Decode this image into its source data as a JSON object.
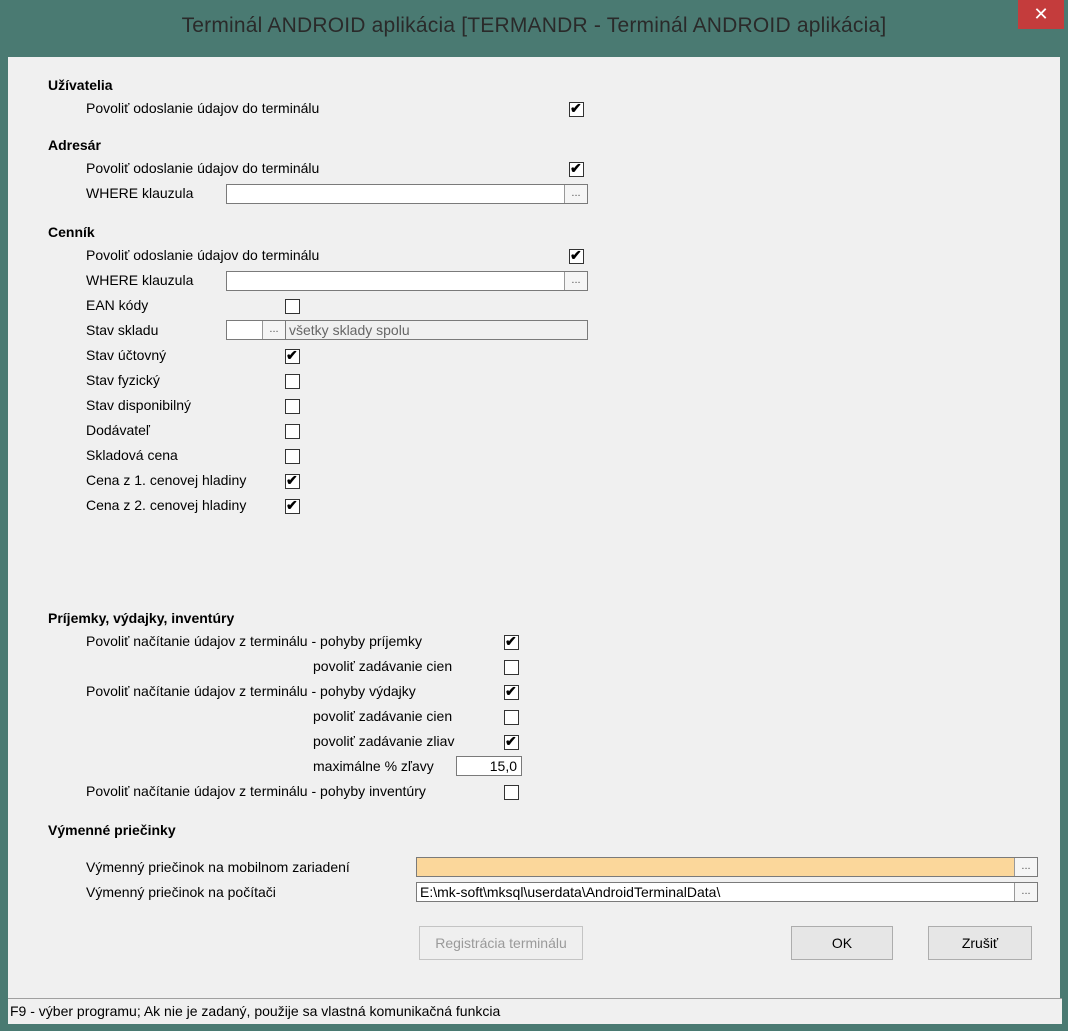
{
  "window": {
    "title": "Terminál ANDROID aplikácia   [TERMANDR - Terminál ANDROID aplikácia]",
    "close_glyph": "✕"
  },
  "uzivatelia": {
    "heading": "Užívatelia",
    "povolit_label": "Povoliť odoslanie údajov do terminálu",
    "povolit_checked": true
  },
  "adresar": {
    "heading": "Adresár",
    "povolit_label": "Povoliť odoslanie údajov do terminálu",
    "povolit_checked": true,
    "where_label": "WHERE klauzula",
    "where_value": ""
  },
  "cennik": {
    "heading": "Cenník",
    "povolit_label": "Povoliť odoslanie údajov do terminálu",
    "povolit_checked": true,
    "where_label": "WHERE klauzula",
    "where_value": "",
    "ean_label": "EAN kódy",
    "ean_checked": false,
    "stav_skladu_label": "Stav skladu",
    "stav_skladu_value": "",
    "stav_skladu_desc": "všetky sklady spolu",
    "stav_uctovny_label": "Stav účtovný",
    "stav_uctovny_checked": true,
    "stav_fyzicky_label": "Stav fyzický",
    "stav_fyzicky_checked": false,
    "stav_disponibilny_label": "Stav disponibilný",
    "stav_disponibilny_checked": false,
    "dodavatel_label": "Dodávateľ",
    "dodavatel_checked": false,
    "skladova_cena_label": "Skladová cena",
    "skladova_cena_checked": false,
    "cena1_label": "Cena z 1. cenovej hladiny",
    "cena1_checked": true,
    "cena2_label": "Cena z 2. cenovej hladiny",
    "cena2_checked": true
  },
  "prijemky": {
    "heading": "Príjemky, výdajky, inventúry",
    "prijemky_label": "Povoliť načítanie údajov z terminálu - pohyby príjemky",
    "prijemky_checked": true,
    "prijemky_cien_label": "povoliť zadávanie cien",
    "prijemky_cien_checked": false,
    "vydajky_label": "Povoliť načítanie údajov z terminálu - pohyby výdajky",
    "vydajky_checked": true,
    "vydajky_cien_label": "povoliť zadávanie cien",
    "vydajky_cien_checked": false,
    "vydajky_zliav_label": "povoliť zadávanie zliav",
    "vydajky_zliav_checked": true,
    "max_zlavy_label": "maximálne % zľavy",
    "max_zlavy_value": "15,0",
    "inventury_label": "Povoliť načítanie údajov z terminálu - pohyby inventúry",
    "inventury_checked": false
  },
  "priecinky": {
    "heading": "Výmenné priečinky",
    "mobil_label": "Výmenný priečinok na mobilnom zariadení",
    "mobil_value": "",
    "pc_label": "Výmenný priečinok na počítači",
    "pc_value": "E:\\mk-soft\\mksql\\userdata\\AndroidTerminalData\\"
  },
  "buttons": {
    "registracia": "Registrácia terminálu",
    "ok": "OK",
    "zrusit": "Zrušiť"
  },
  "ellipsis": "...",
  "status_text": "F9 - výber programu; Ak nie je zadaný, použije sa vlastná komunikačná funkcia",
  "colors": {
    "titlebar": "#4a7a72",
    "close": "#c43c3c",
    "active_field": "#fbd79b"
  }
}
